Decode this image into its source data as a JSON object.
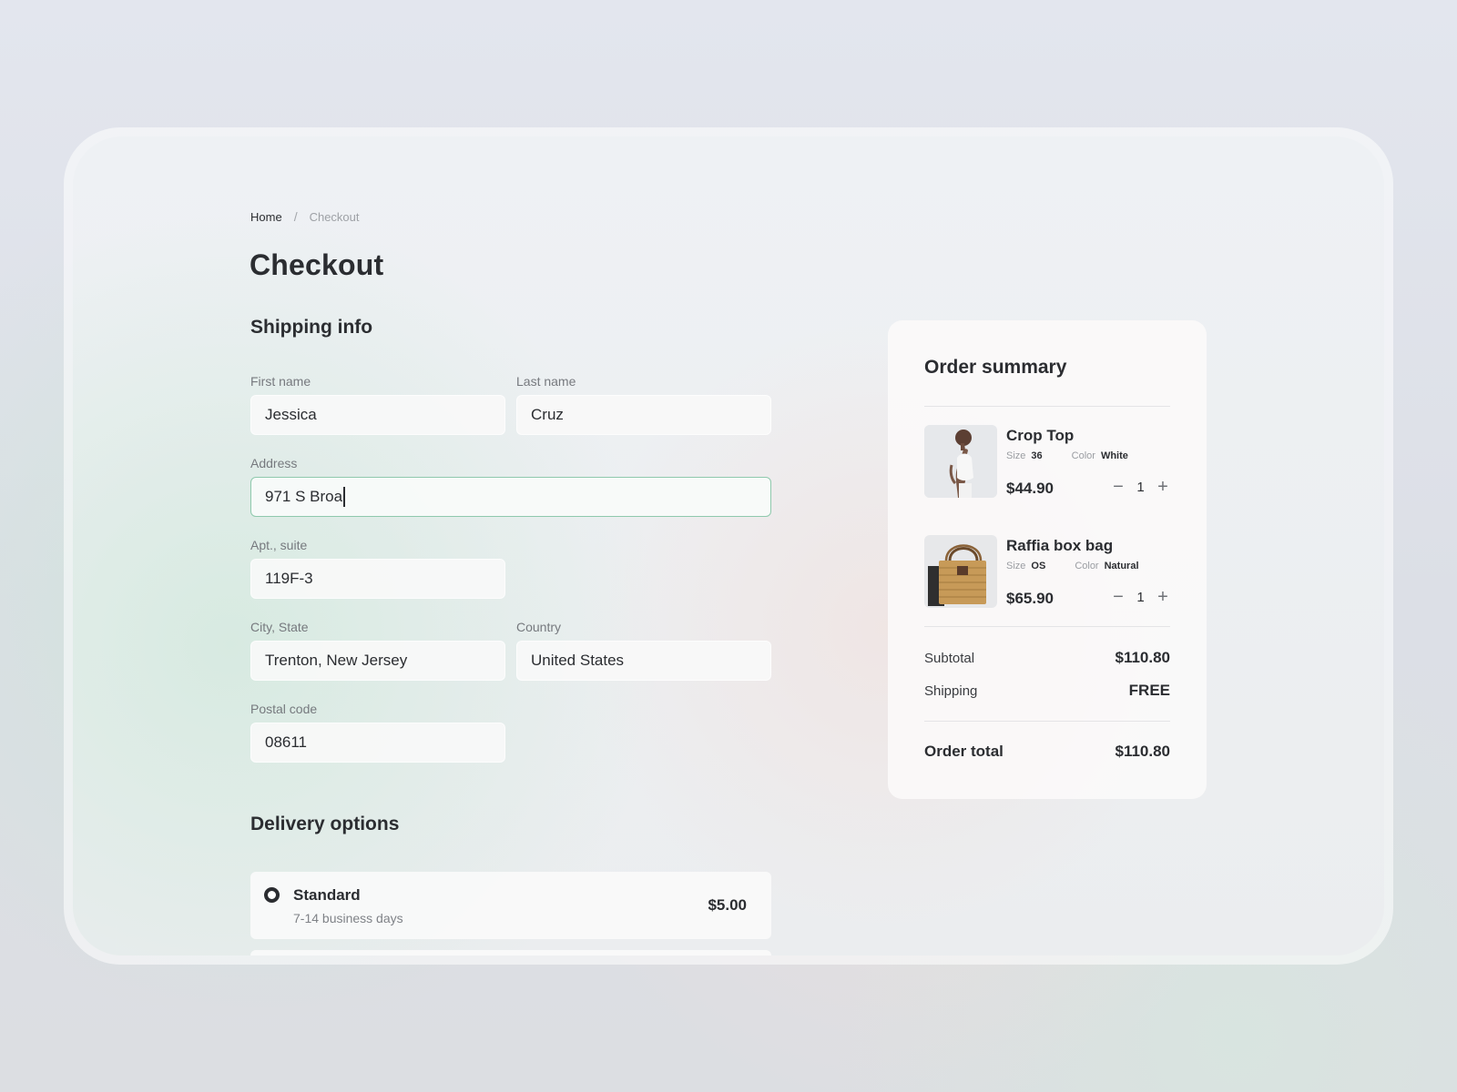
{
  "breadcrumb": {
    "home": "Home",
    "separator": "/",
    "current": "Checkout"
  },
  "page_title": "Checkout",
  "shipping": {
    "title": "Shipping info",
    "first_name": {
      "label": "First name",
      "value": "Jessica"
    },
    "last_name": {
      "label": "Last name",
      "value": "Cruz"
    },
    "address": {
      "label": "Address",
      "value": "971 S Broa"
    },
    "apt": {
      "label": "Apt., suite",
      "value": "119F-3"
    },
    "city": {
      "label": "City, State",
      "value": "Trenton, New Jersey"
    },
    "country": {
      "label": "Country",
      "value": "United States"
    },
    "postal": {
      "label": "Postal code",
      "value": "08611"
    }
  },
  "delivery": {
    "title": "Delivery options",
    "options": [
      {
        "name": "Standard",
        "eta": "7-14 business days",
        "price": "$5.00",
        "selected": true
      }
    ]
  },
  "summary": {
    "title": "Order summary",
    "items": [
      {
        "name": "Crop Top",
        "size_label": "Size",
        "size": "36",
        "color_label": "Color",
        "color": "White",
        "price": "$44.90",
        "qty": "1"
      },
      {
        "name": "Raffia box bag",
        "size_label": "Size",
        "size": "OS",
        "color_label": "Color",
        "color": "Natural",
        "price": "$65.90",
        "qty": "1"
      }
    ],
    "subtotal_label": "Subtotal",
    "subtotal": "$110.80",
    "shipping_label": "Shipping",
    "shipping_value": "FREE",
    "total_label": "Order total",
    "total": "$110.80"
  },
  "colors": {
    "focus_border": "#8fc9ad",
    "text_dark": "#2b2d31",
    "text_muted": "#76797e"
  },
  "icons": {
    "decrement": "minus-icon",
    "increment": "plus-icon"
  }
}
